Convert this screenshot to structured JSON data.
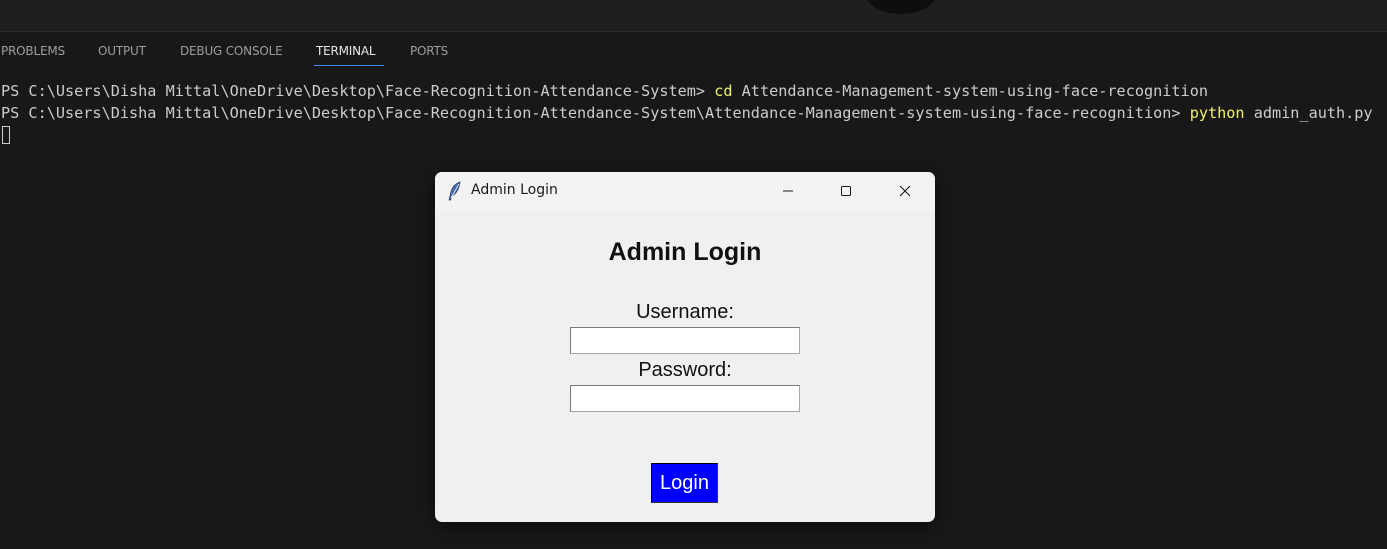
{
  "panel": {
    "tabs": [
      {
        "label": "PROBLEMS"
      },
      {
        "label": "OUTPUT"
      },
      {
        "label": "DEBUG CONSOLE"
      },
      {
        "label": "TERMINAL"
      },
      {
        "label": "PORTS"
      }
    ],
    "active_tab": "TERMINAL"
  },
  "terminal": {
    "lines": [
      {
        "prompt": "PS C:\\Users\\Disha Mittal\\OneDrive\\Desktop\\Face-Recognition-Attendance-System> ",
        "command": "cd",
        "args": " Attendance-Management-system-using-face-recognition"
      },
      {
        "prompt": "PS C:\\Users\\Disha Mittal\\OneDrive\\Desktop\\Face-Recognition-Attendance-System\\Attendance-Management-system-using-face-recognition> ",
        "command": "python",
        "args": " admin_auth.py"
      }
    ]
  },
  "window": {
    "title": "Admin Login",
    "icon": "feather-icon",
    "controls": [
      "minimize-icon",
      "maximize-icon",
      "close-icon"
    ]
  },
  "form": {
    "heading": "Admin Login",
    "username_label": "Username:",
    "username_value": "",
    "password_label": "Password:",
    "password_value": "",
    "login_label": "Login"
  },
  "colors": {
    "terminal_bg": "#181818",
    "terminal_text": "#cccccc",
    "command_highlight": "#f1f16b",
    "active_tab_underline": "#3b8eea",
    "window_bg": "#f0f0f0",
    "login_button_bg": "#0000ff",
    "login_button_text": "#ffffff"
  }
}
